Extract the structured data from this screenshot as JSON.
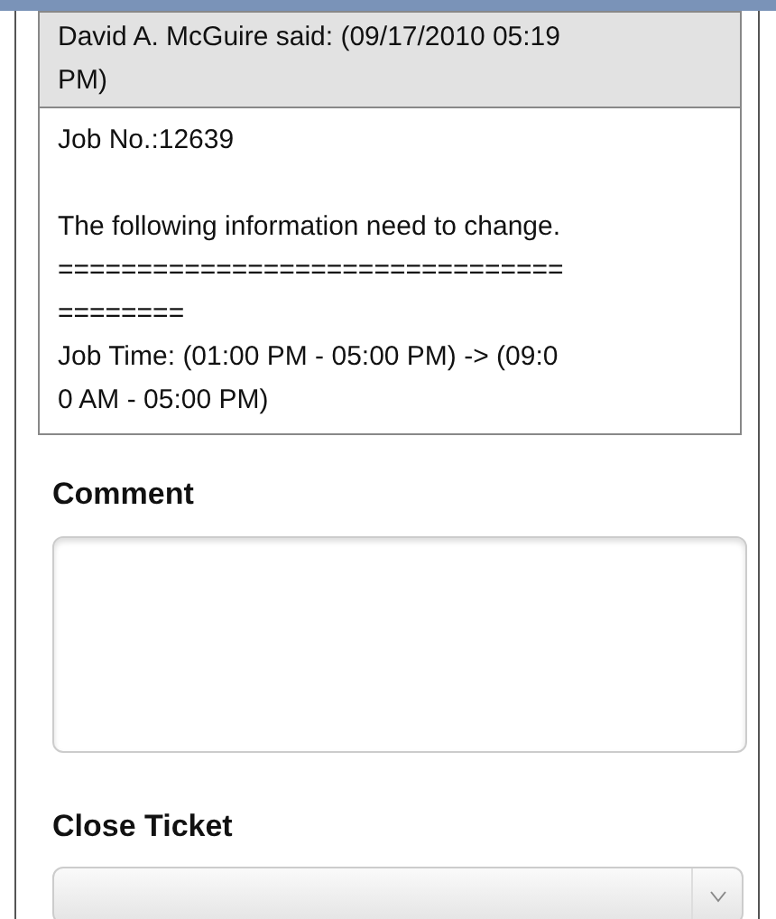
{
  "message": {
    "header": "David A. McGuire said: (09/17/2010 05:19 PM)",
    "body": [
      "Job No.:12639",
      "The following information need to change.",
      "========================================",
      "Job Time: (01:00 PM - 05:00 PM) -> (09:00 AM - 05:00 PM)"
    ]
  },
  "comment": {
    "label": "Comment"
  },
  "close_ticket": {
    "label": "Close Ticket"
  }
}
